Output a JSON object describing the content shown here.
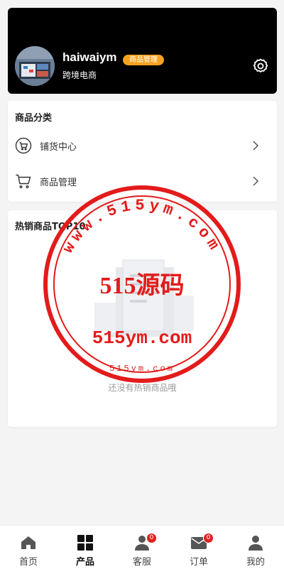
{
  "profile": {
    "username": "haiwaiym",
    "role_badge": "商品管理",
    "shop_name": "跨境电商",
    "badge_color": "#f5a21f"
  },
  "category": {
    "title": "商品分类",
    "items": [
      {
        "label": "铺货中心",
        "icon": "cart-circle-icon"
      },
      {
        "label": "商品管理",
        "icon": "cart-icon"
      }
    ]
  },
  "top_sellers": {
    "title": "热销商品TOP10",
    "empty_text": "还没有热销商品哦"
  },
  "watermark": {
    "ring_text": "www.515ym.com",
    "main": "515源码",
    "sub": "515ym.com",
    "bottom": "515ym.com",
    "color": "#e31b1b"
  },
  "tabbar": {
    "tabs": [
      {
        "label": "首页",
        "icon": "home-icon"
      },
      {
        "label": "产品",
        "icon": "grid-icon"
      },
      {
        "label": "客服",
        "icon": "user-icon",
        "badge": "0"
      },
      {
        "label": "订单",
        "icon": "mail-icon",
        "badge": "0"
      },
      {
        "label": "我的",
        "icon": "user-icon"
      }
    ]
  }
}
